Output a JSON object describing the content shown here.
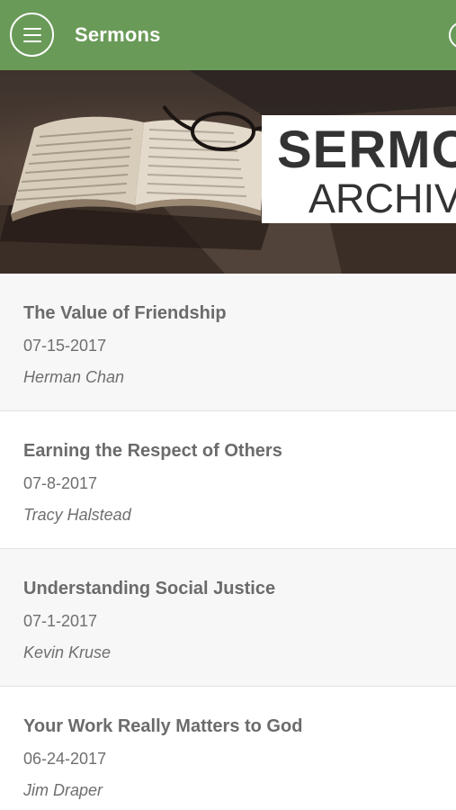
{
  "app_bar": {
    "title": "Sermons",
    "color": "#6a9a58",
    "menu_icon": "hamburger-menu-icon",
    "right_icon": "circle-icon"
  },
  "hero": {
    "title": "SERMO",
    "subtitle": "ARCHIVE"
  },
  "sermons": [
    {
      "title": "The Value of Friendship",
      "date": "07-15-2017",
      "speaker": "Herman Chan"
    },
    {
      "title": "Earning the Respect of Others",
      "date": "07-8-2017",
      "speaker": "Tracy Halstead"
    },
    {
      "title": "Understanding Social Justice",
      "date": "07-1-2017",
      "speaker": "Kevin Kruse"
    },
    {
      "title": "Your Work Really Matters to God",
      "date": "06-24-2017",
      "speaker": "Jim Draper"
    }
  ]
}
